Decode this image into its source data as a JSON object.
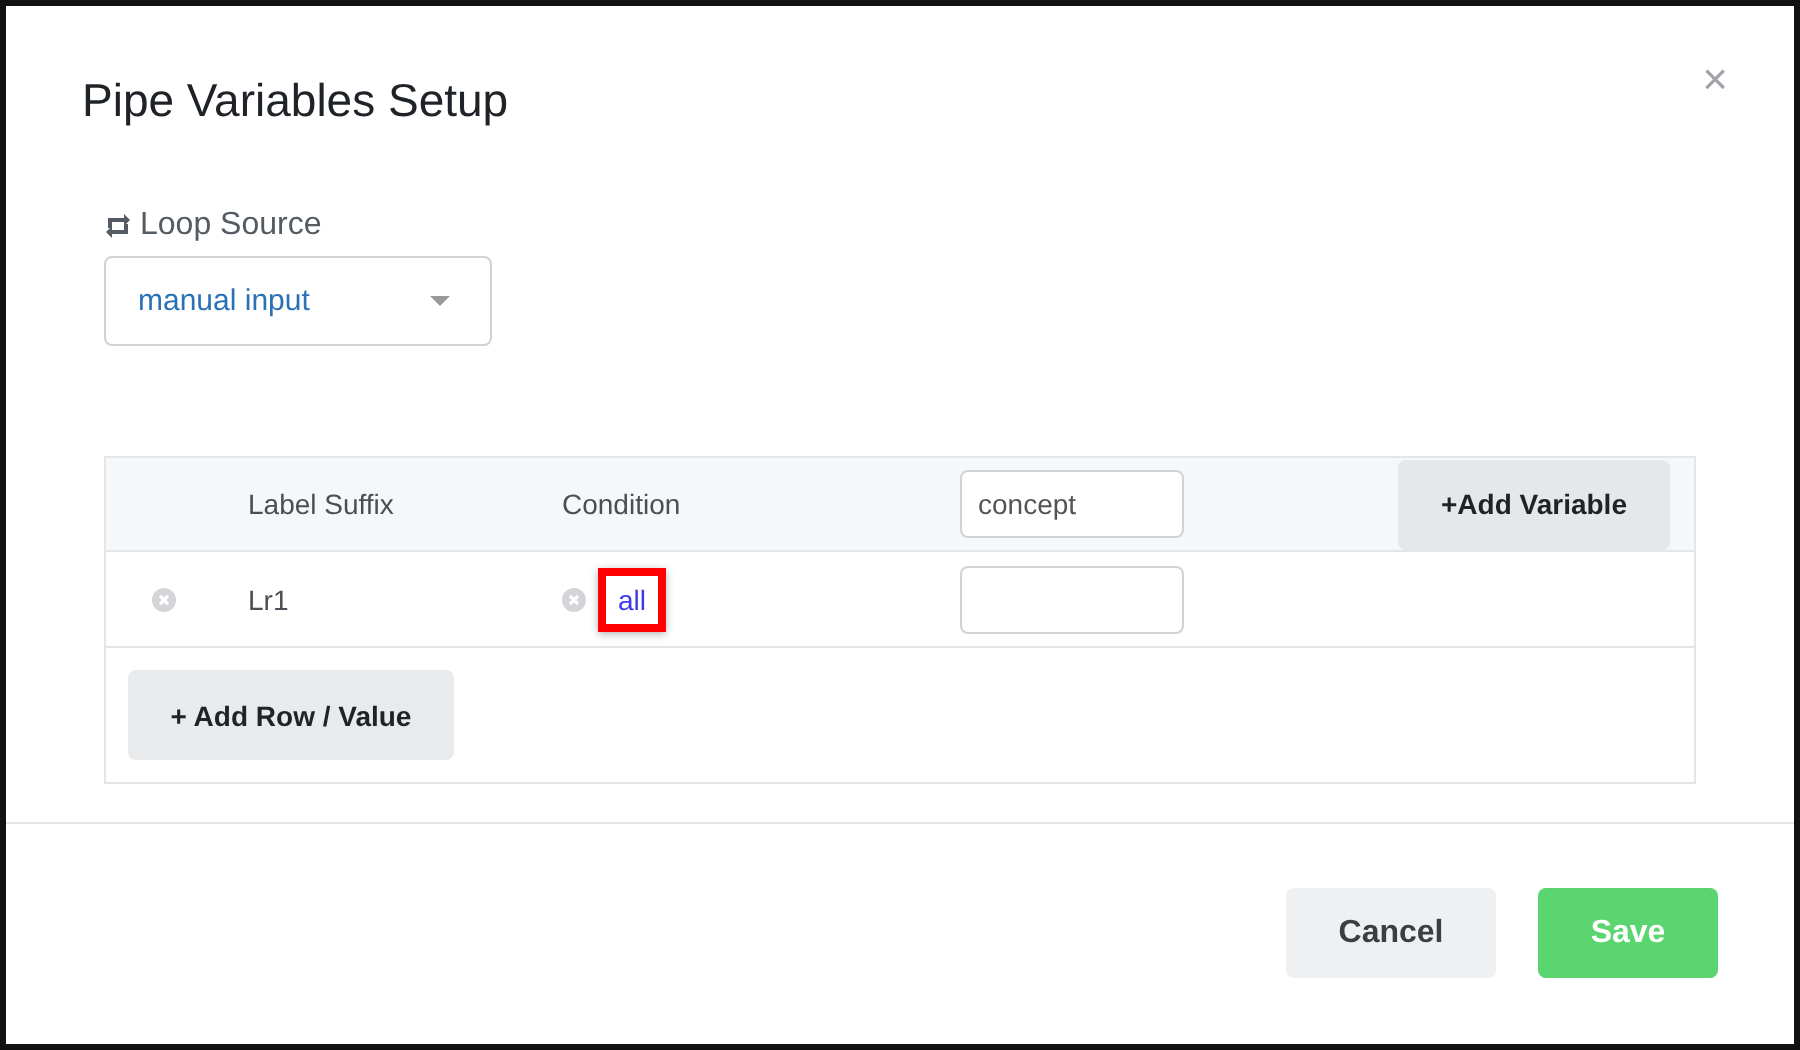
{
  "dialog": {
    "title": "Pipe Variables Setup",
    "close": "×"
  },
  "loop_source": {
    "label": "Loop Source",
    "value": "manual input"
  },
  "table": {
    "columns": [
      "Label Suffix",
      "Condition"
    ],
    "variable_input": {
      "value": "concept"
    },
    "add_variable": "+Add Variable",
    "rows": [
      {
        "label_suffix": "Lr1",
        "condition": "all",
        "condition_highlighted": true,
        "variable_value": ""
      }
    ],
    "add_row": "+ Add Row / Value"
  },
  "buttons": [
    {
      "kind": "secondary",
      "label": "Cancel"
    },
    {
      "kind": "primary",
      "label": "Save"
    }
  ]
}
